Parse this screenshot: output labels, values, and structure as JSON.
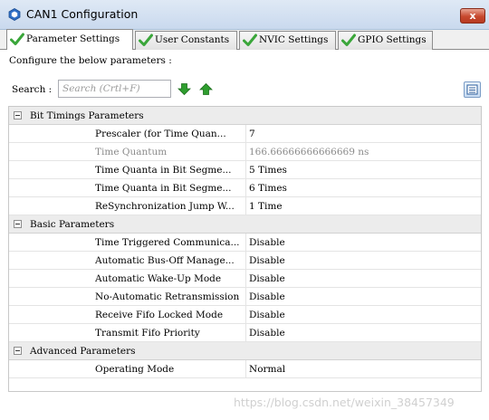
{
  "window": {
    "title": "CAN1 Configuration",
    "close_label": "x"
  },
  "tabs": [
    {
      "label": "Parameter Settings",
      "active": true
    },
    {
      "label": "User Constants",
      "active": false
    },
    {
      "label": "NVIC Settings",
      "active": false
    },
    {
      "label": "GPIO Settings",
      "active": false
    }
  ],
  "intro_text": "Configure the below parameters :",
  "search": {
    "label": "Search :",
    "placeholder": "Search (Crtl+F)"
  },
  "groups": [
    {
      "label": "Bit Timings Parameters",
      "params": [
        {
          "name": "Prescaler (for Time Quan...",
          "value": "7",
          "readonly": false
        },
        {
          "name": "Time Quantum",
          "value": "166.66666666666669 ns",
          "readonly": true
        },
        {
          "name": "Time Quanta in Bit Segme...",
          "value": "5 Times",
          "readonly": false
        },
        {
          "name": "Time Quanta in Bit Segme...",
          "value": "6 Times",
          "readonly": false
        },
        {
          "name": "ReSynchronization Jump W...",
          "value": "1 Time",
          "readonly": false
        }
      ]
    },
    {
      "label": "Basic Parameters",
      "params": [
        {
          "name": "Time Triggered Communica...",
          "value": "Disable",
          "readonly": false
        },
        {
          "name": "Automatic Bus-Off Manage...",
          "value": "Disable",
          "readonly": false
        },
        {
          "name": "Automatic Wake-Up Mode",
          "value": "Disable",
          "readonly": false
        },
        {
          "name": "No-Automatic Retransmission",
          "value": "Disable",
          "readonly": false
        },
        {
          "name": "Receive Fifo Locked Mode",
          "value": "Disable",
          "readonly": false
        },
        {
          "name": "Transmit Fifo Priority",
          "value": "Disable",
          "readonly": false
        }
      ]
    },
    {
      "label": "Advanced Parameters",
      "params": [
        {
          "name": "Operating Mode",
          "value": "Normal",
          "readonly": false
        }
      ]
    }
  ],
  "watermark": "https://blog.csdn.net/weixin_38457349",
  "colors": {
    "titlebar": "#c9d9ee",
    "close": "#c7482e",
    "check_green": "#3aa63a",
    "arrow_green": "#2f9e2f",
    "group_row": "#ececec",
    "readonly_text": "#8a8a8a"
  }
}
